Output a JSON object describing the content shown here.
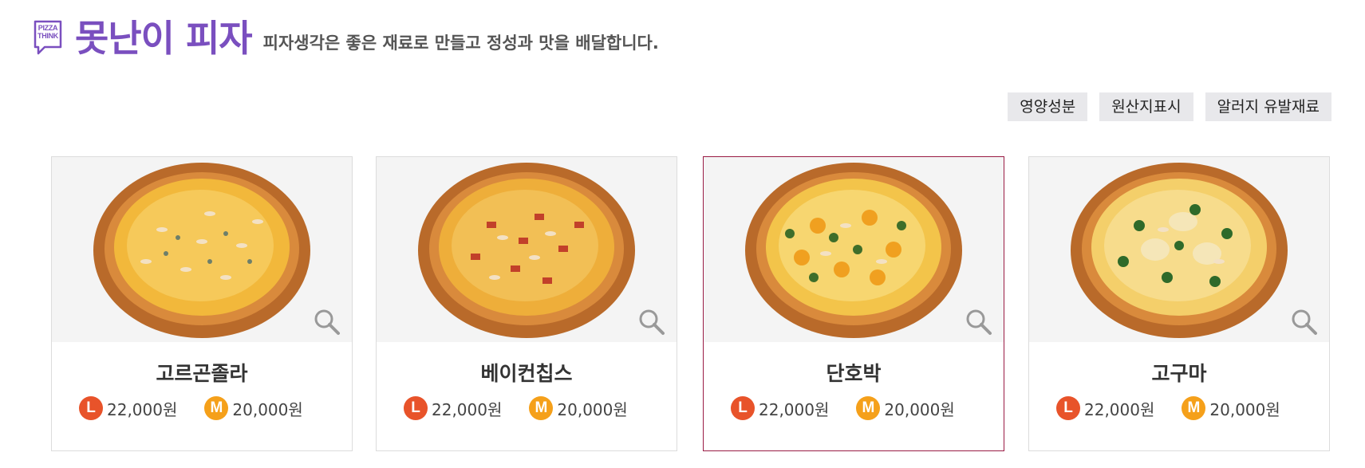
{
  "header": {
    "logo_text": "PIZZA THINK",
    "brand": "못난이 피자",
    "tagline": "피자생각은 좋은 재료로 만들고 정성과 맛을 배달합니다."
  },
  "info_buttons": [
    "영양성분",
    "원산지표시",
    "알러지 유발재료"
  ],
  "colors": {
    "brand": "#7a4fbf",
    "size_L": "#e8532a",
    "size_M": "#f5a01a",
    "selected_border": "#9a1b44"
  },
  "icons": {
    "zoom": "magnifier-icon"
  },
  "products": [
    {
      "name": "고르곤졸라",
      "sizes": [
        {
          "size": "L",
          "price": "22,000원"
        },
        {
          "size": "M",
          "price": "20,000원"
        }
      ],
      "selected": false
    },
    {
      "name": "베이컨칩스",
      "sizes": [
        {
          "size": "L",
          "price": "22,000원"
        },
        {
          "size": "M",
          "price": "20,000원"
        }
      ],
      "selected": false
    },
    {
      "name": "단호박",
      "sizes": [
        {
          "size": "L",
          "price": "22,000원"
        },
        {
          "size": "M",
          "price": "20,000원"
        }
      ],
      "selected": true
    },
    {
      "name": "고구마",
      "sizes": [
        {
          "size": "L",
          "price": "22,000원"
        },
        {
          "size": "M",
          "price": "20,000원"
        }
      ],
      "selected": false
    }
  ]
}
